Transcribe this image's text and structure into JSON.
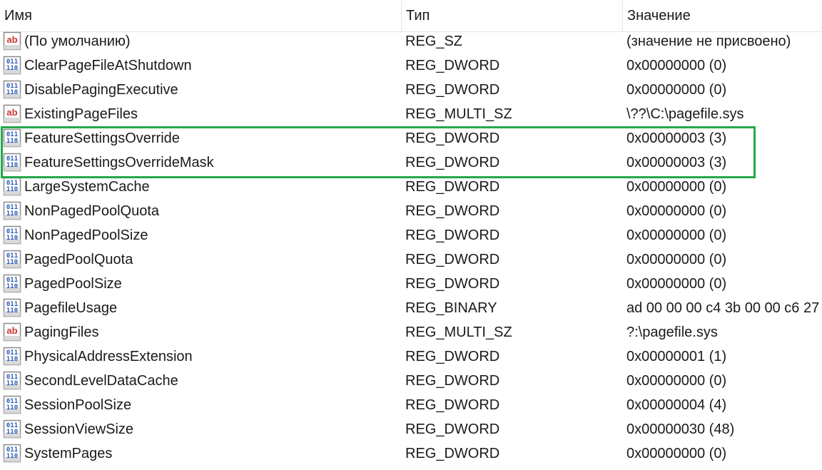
{
  "columns": {
    "name": "Имя",
    "type": "Тип",
    "data": "Значение"
  },
  "colors": {
    "highlight": "#23a84c"
  },
  "rows": [
    {
      "icon": "string-value-icon",
      "name": "(По умолчанию)",
      "type": "REG_SZ",
      "data": "(значение не присвоено)"
    },
    {
      "icon": "binary-value-icon",
      "name": "ClearPageFileAtShutdown",
      "type": "REG_DWORD",
      "data": "0x00000000 (0)"
    },
    {
      "icon": "binary-value-icon",
      "name": "DisablePagingExecutive",
      "type": "REG_DWORD",
      "data": "0x00000000 (0)"
    },
    {
      "icon": "string-value-icon",
      "name": "ExistingPageFiles",
      "type": "REG_MULTI_SZ",
      "data": "\\??\\C:\\pagefile.sys"
    },
    {
      "icon": "binary-value-icon",
      "name": "FeatureSettingsOverride",
      "type": "REG_DWORD",
      "data": "0x00000003 (3)"
    },
    {
      "icon": "binary-value-icon",
      "name": "FeatureSettingsOverrideMask",
      "type": "REG_DWORD",
      "data": "0x00000003 (3)"
    },
    {
      "icon": "binary-value-icon",
      "name": "LargeSystemCache",
      "type": "REG_DWORD",
      "data": "0x00000000 (0)"
    },
    {
      "icon": "binary-value-icon",
      "name": "NonPagedPoolQuota",
      "type": "REG_DWORD",
      "data": "0x00000000 (0)"
    },
    {
      "icon": "binary-value-icon",
      "name": "NonPagedPoolSize",
      "type": "REG_DWORD",
      "data": "0x00000000 (0)"
    },
    {
      "icon": "binary-value-icon",
      "name": "PagedPoolQuota",
      "type": "REG_DWORD",
      "data": "0x00000000 (0)"
    },
    {
      "icon": "binary-value-icon",
      "name": "PagedPoolSize",
      "type": "REG_DWORD",
      "data": "0x00000000 (0)"
    },
    {
      "icon": "binary-value-icon",
      "name": "PagefileUsage",
      "type": "REG_BINARY",
      "data": "ad 00 00 00 c4 3b 00 00 c6 27"
    },
    {
      "icon": "string-value-icon",
      "name": "PagingFiles",
      "type": "REG_MULTI_SZ",
      "data": "?:\\pagefile.sys"
    },
    {
      "icon": "binary-value-icon",
      "name": "PhysicalAddressExtension",
      "type": "REG_DWORD",
      "data": "0x00000001 (1)"
    },
    {
      "icon": "binary-value-icon",
      "name": "SecondLevelDataCache",
      "type": "REG_DWORD",
      "data": "0x00000000 (0)"
    },
    {
      "icon": "binary-value-icon",
      "name": "SessionPoolSize",
      "type": "REG_DWORD",
      "data": "0x00000004 (4)"
    },
    {
      "icon": "binary-value-icon",
      "name": "SessionViewSize",
      "type": "REG_DWORD",
      "data": "0x00000030 (48)"
    },
    {
      "icon": "binary-value-icon",
      "name": "SystemPages",
      "type": "REG_DWORD",
      "data": "0x00000000 (0)"
    }
  ]
}
